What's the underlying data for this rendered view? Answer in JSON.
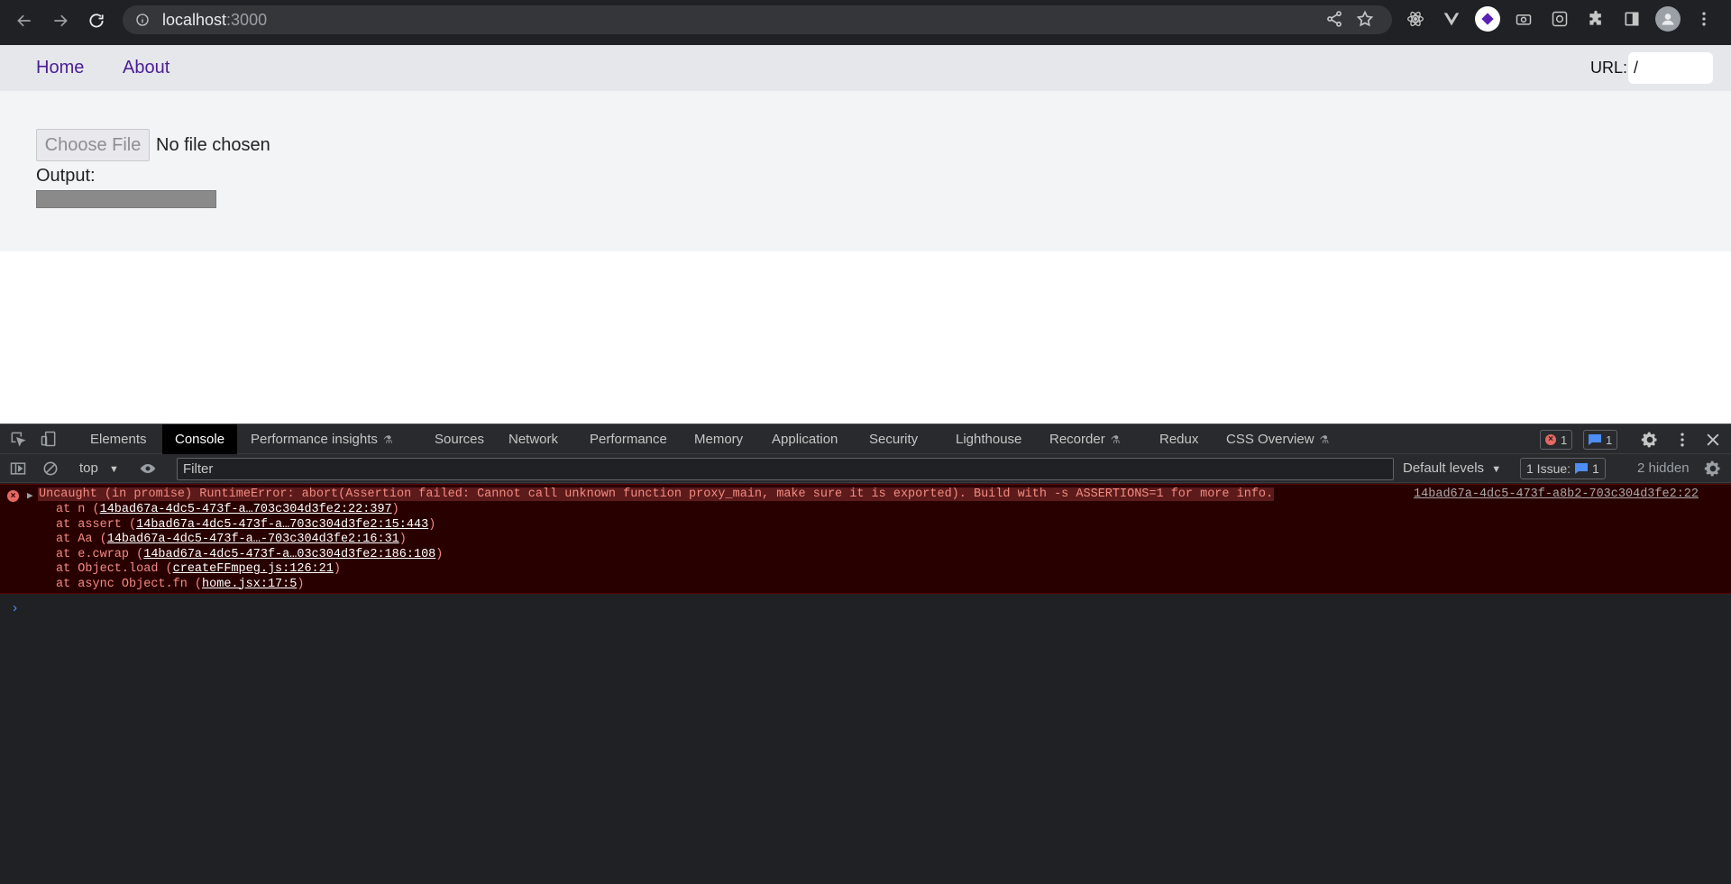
{
  "browser": {
    "url_host": "localhost",
    "url_port": ":3000"
  },
  "page": {
    "nav": {
      "home": "Home",
      "about": "About"
    },
    "url_label": "URL:",
    "url_value": "/",
    "choose_file": "Choose File",
    "no_file": "No file chosen",
    "output_label": "Output:"
  },
  "devtools": {
    "tabs": [
      {
        "label": "Elements"
      },
      {
        "label": "Console"
      },
      {
        "label": "Performance insights"
      },
      {
        "label": "Sources"
      },
      {
        "label": "Network"
      },
      {
        "label": "Performance"
      },
      {
        "label": "Memory"
      },
      {
        "label": "Application"
      },
      {
        "label": "Security"
      },
      {
        "label": "Lighthouse"
      },
      {
        "label": "Recorder"
      },
      {
        "label": "Redux"
      },
      {
        "label": "CSS Overview"
      }
    ],
    "error_count": "1",
    "message_count": "1",
    "toolbar": {
      "context": "top",
      "filter_placeholder": "Filter",
      "levels": "Default levels",
      "issues": "1 Issue:",
      "issues_count": "1",
      "hidden": "2 hidden"
    },
    "error": {
      "message": "Uncaught (in promise) RuntimeError: abort(Assertion failed: Cannot call unknown function proxy_main, make sure it is exported). Build with -s ASSERTIONS=1 for more info.",
      "source": "14bad67a-4dc5-473f-a8b2-703c304d3fe2:22",
      "trace": [
        {
          "prefix": "at n (",
          "link": "14bad67a-4dc5-473f-a…703c304d3fe2:22:397",
          "suffix": ")"
        },
        {
          "prefix": "at assert (",
          "link": "14bad67a-4dc5-473f-a…703c304d3fe2:15:443",
          "suffix": ")"
        },
        {
          "prefix": "at Aa (",
          "link": "14bad67a-4dc5-473f-a…-703c304d3fe2:16:31",
          "suffix": ")"
        },
        {
          "prefix": "at e.cwrap (",
          "link": "14bad67a-4dc5-473f-a…03c304d3fe2:186:108",
          "suffix": ")"
        },
        {
          "prefix": "at Object.load (",
          "link": "createFFmpeg.js:126:21",
          "suffix": ")"
        },
        {
          "prefix": "at async Object.fn (",
          "link": "home.jsx:17:5",
          "suffix": ")"
        }
      ]
    }
  }
}
